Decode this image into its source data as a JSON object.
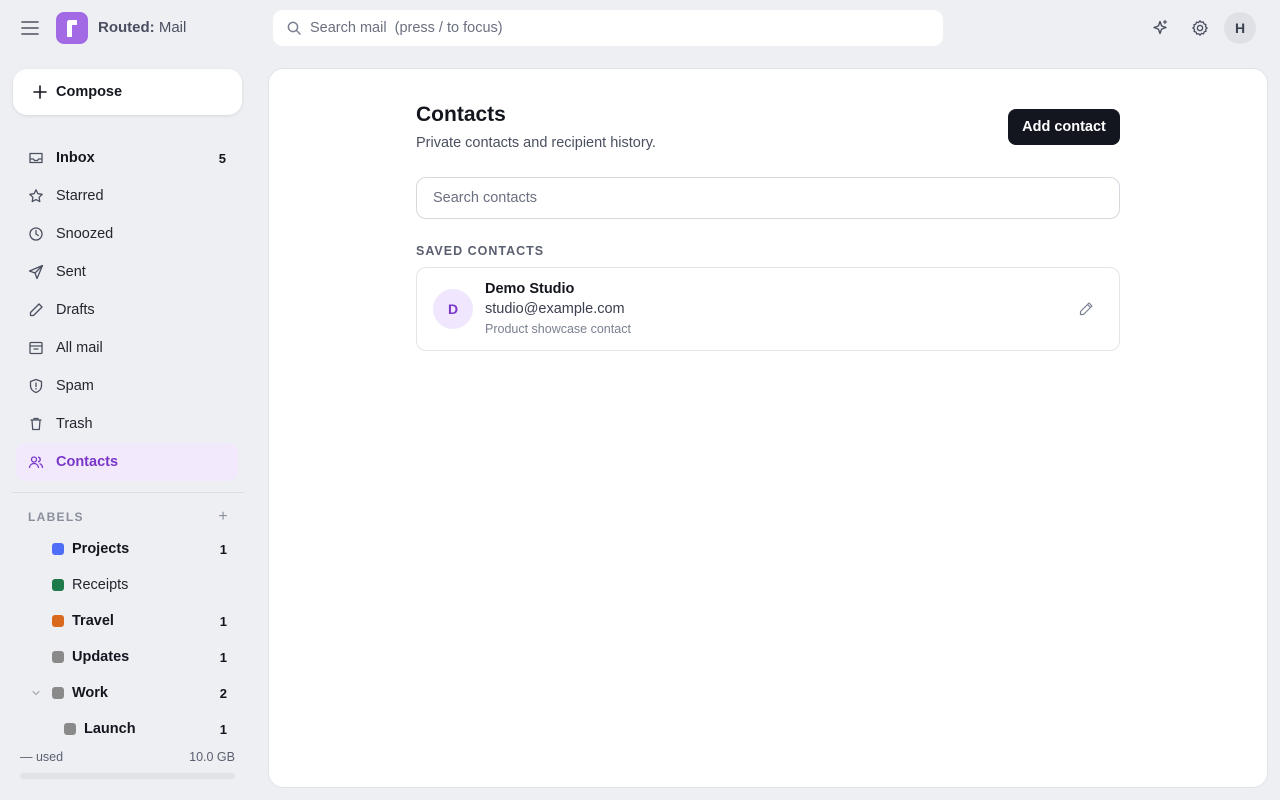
{
  "app": {
    "brand": "Routed:",
    "product": "Mail",
    "logo_letter": "r"
  },
  "search": {
    "placeholder": "Search mail  (press / to focus)"
  },
  "user": {
    "initial": "H"
  },
  "sidebar": {
    "compose_label": "Compose",
    "nav": [
      {
        "label": "Inbox",
        "count": "5",
        "icon": "inbox-icon"
      },
      {
        "label": "Starred",
        "count": "",
        "icon": "star-icon"
      },
      {
        "label": "Snoozed",
        "count": "",
        "icon": "clock-icon"
      },
      {
        "label": "Sent",
        "count": "",
        "icon": "send-icon"
      },
      {
        "label": "Drafts",
        "count": "",
        "icon": "pencil-icon"
      },
      {
        "label": "All mail",
        "count": "",
        "icon": "archive-icon"
      },
      {
        "label": "Spam",
        "count": "",
        "icon": "shield-icon"
      },
      {
        "label": "Trash",
        "count": "",
        "icon": "trash-icon"
      },
      {
        "label": "Contacts",
        "count": "",
        "icon": "contacts-icon",
        "active": true
      }
    ],
    "labels_heading": "LABELS",
    "labels_add": "+",
    "labels": [
      {
        "name": "Projects",
        "count": "1",
        "color": "#4f6ef7"
      },
      {
        "name": "Receipts",
        "count": "",
        "color": "#1f7a4a"
      },
      {
        "name": "Travel",
        "count": "1",
        "color": "#d9691c"
      },
      {
        "name": "Updates",
        "count": "1",
        "color": "#8a8a8a"
      },
      {
        "name": "Work",
        "count": "2",
        "color": "#8a8a8a",
        "expanded": true
      },
      {
        "name": "Launch",
        "count": "1",
        "color": "#8a8a8a",
        "child": true
      }
    ],
    "storage": {
      "used": "— used",
      "total": "10.0 GB",
      "fraction": 0
    }
  },
  "main": {
    "title": "Contacts",
    "subtitle": "Private contacts and recipient history.",
    "add_button": "Add contact",
    "search_placeholder": "Search contacts",
    "section_heading": "SAVED CONTACTS",
    "contacts": [
      {
        "initial": "D",
        "name": "Demo Studio",
        "email": "studio@example.com",
        "note": "Product showcase contact"
      }
    ]
  },
  "colors": {
    "accent": "#a36ae6",
    "accent_text": "#7a36c9",
    "active_bg": "#f2e9fd",
    "primary_button": "#14161f",
    "page_bg": "#eeeff3"
  }
}
